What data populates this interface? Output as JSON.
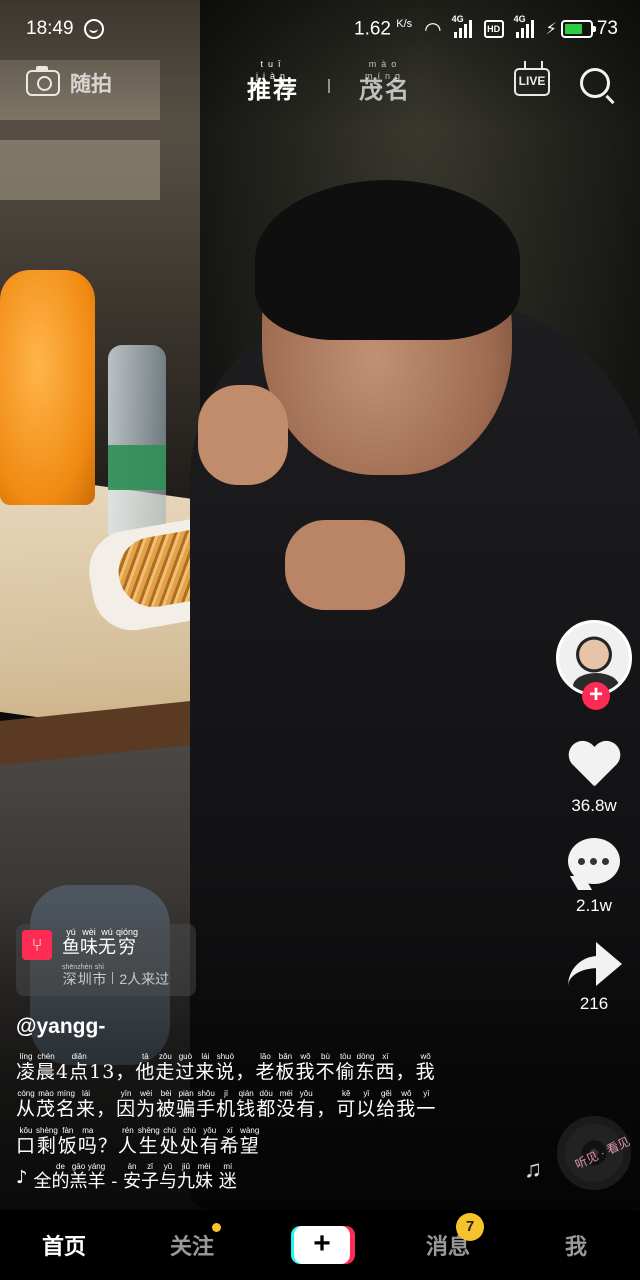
{
  "status_bar": {
    "time": "18:49",
    "net_speed": "1.62",
    "net_speed_unit": "K/s",
    "signal1_label": "4G",
    "hd_label": "HD",
    "signal2_label": "4G",
    "battery_level": "73"
  },
  "top_nav": {
    "camera_label": "随拍",
    "tabs": [
      {
        "pinyin": "tuī jiàn",
        "label": "推荐",
        "active": true
      },
      {
        "pinyin": "mào míng",
        "label": "茂名",
        "active": false
      }
    ],
    "live_label": "LIVE"
  },
  "rail": {
    "likes": "36.8w",
    "comments": "2.1w",
    "shares": "216",
    "music_disc_text": "听见 · 看见",
    "follow_symbol": "+"
  },
  "poi": {
    "title": "鱼味无穷",
    "title_pinyin": [
      "yú",
      "wèi",
      "wú",
      "qióng"
    ],
    "location": "深圳市",
    "location_pinyin": [
      "shēn",
      "zhèn",
      "shì"
    ],
    "visitors": "2人来过"
  },
  "post": {
    "author": "@yangg-",
    "caption_lines": [
      [
        [
          "凌",
          "líng"
        ],
        [
          "晨",
          "chén"
        ],
        [
          "4",
          ""
        ],
        [
          "点",
          "diǎn"
        ],
        [
          "1",
          ""
        ],
        [
          "3",
          ""
        ],
        [
          "，",
          ""
        ],
        [
          "他",
          "tā"
        ],
        [
          "走",
          "zǒu"
        ],
        [
          "过",
          "guò"
        ],
        [
          "来",
          "lái"
        ],
        [
          "说",
          "shuō"
        ],
        [
          "，",
          ""
        ],
        [
          "老",
          "lǎo"
        ],
        [
          "板",
          "bǎn"
        ],
        [
          "我",
          "wǒ"
        ],
        [
          "不",
          "bù"
        ],
        [
          "偷",
          "tōu"
        ],
        [
          "东",
          "dōng"
        ],
        [
          "西",
          "xī"
        ],
        [
          "，",
          ""
        ],
        [
          "我",
          "wǒ"
        ]
      ],
      [
        [
          "从",
          "cóng"
        ],
        [
          "茂",
          "mào"
        ],
        [
          "名",
          "míng"
        ],
        [
          "来",
          "lái"
        ],
        [
          "，",
          ""
        ],
        [
          "因",
          "yīn"
        ],
        [
          "为",
          "wèi"
        ],
        [
          "被",
          "bèi"
        ],
        [
          "骗",
          "piàn"
        ],
        [
          "手",
          "shǒu"
        ],
        [
          "机",
          "jī"
        ],
        [
          "钱",
          "qián"
        ],
        [
          "都",
          "dōu"
        ],
        [
          "没",
          "méi"
        ],
        [
          "有",
          "yǒu"
        ],
        [
          "，",
          ""
        ],
        [
          "可",
          "kě"
        ],
        [
          "以",
          "yǐ"
        ],
        [
          "给",
          "gěi"
        ],
        [
          "我",
          "wǒ"
        ],
        [
          "一",
          "yī"
        ]
      ],
      [
        [
          "口",
          "kǒu"
        ],
        [
          "剩",
          "shèng"
        ],
        [
          "饭",
          "fàn"
        ],
        [
          "吗",
          "ma"
        ],
        [
          "？",
          ""
        ],
        [
          "人",
          "rén"
        ],
        [
          "生",
          "shēng"
        ],
        [
          "处",
          "chù"
        ],
        [
          "处",
          "chù"
        ],
        [
          "有",
          "yǒu"
        ],
        [
          "希",
          "xī"
        ],
        [
          "望",
          "wàng"
        ]
      ]
    ],
    "music": [
      [
        "全",
        ""
      ],
      [
        "的",
        "de"
      ],
      [
        "羔",
        "gāo"
      ],
      [
        "羊",
        "yáng"
      ],
      [
        " - ",
        ""
      ],
      [
        "安",
        "ān"
      ],
      [
        "子",
        "zǐ"
      ],
      [
        "与",
        "yǔ"
      ],
      [
        "九",
        "jiǔ"
      ],
      [
        "妹",
        "mèi"
      ],
      [
        "   ",
        ""
      ],
      [
        "迷",
        "mí"
      ]
    ]
  },
  "tabbar": {
    "home": "首页",
    "following": "关注",
    "create": "+",
    "messages": "消息",
    "messages_badge": "7",
    "me": "我"
  },
  "colors": {
    "accent_red": "#fe2c55",
    "accent_cyan": "#25f4ee",
    "badge_yellow": "#f5c32b",
    "battery_green": "#2ecc40"
  }
}
